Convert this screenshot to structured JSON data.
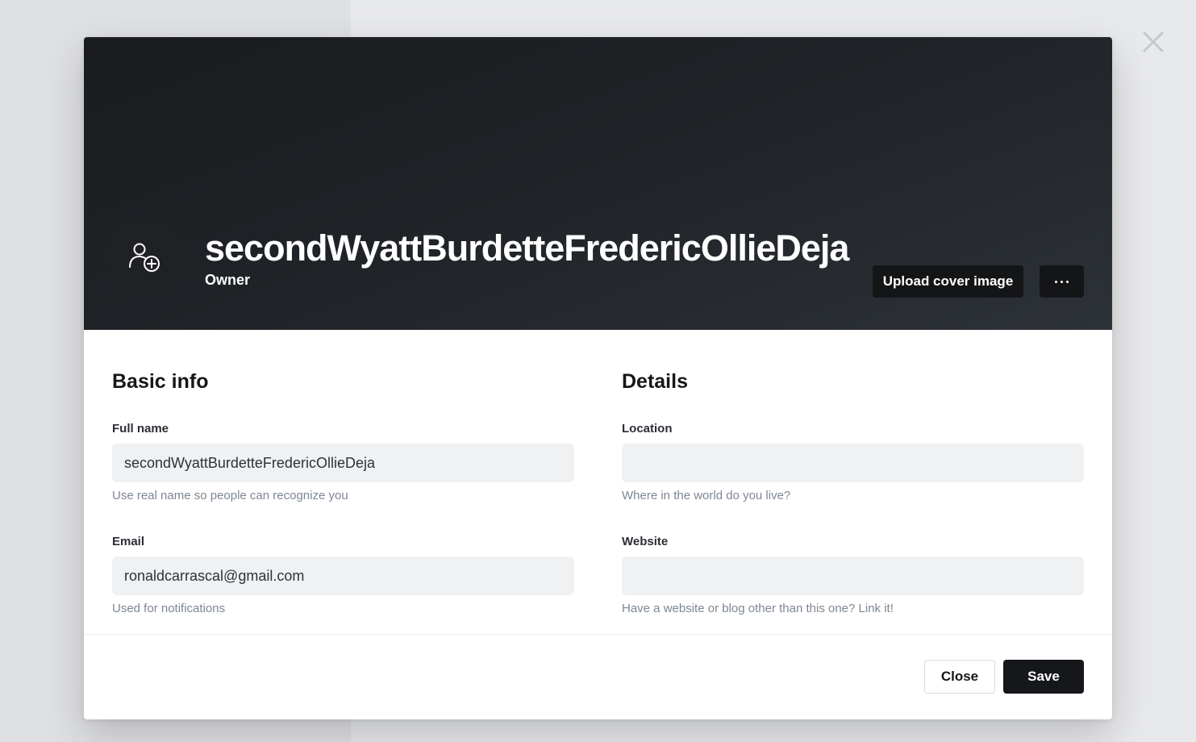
{
  "profile": {
    "name": "secondWyattBurdetteFredericOllieDeja",
    "role": "Owner",
    "avatar_icon": "user-add-icon"
  },
  "cover": {
    "upload_label": "Upload cover image",
    "more_icon": "ellipsis-icon"
  },
  "basic_info": {
    "title": "Basic info",
    "full_name": {
      "label": "Full name",
      "value": "secondWyattBurdetteFredericOllieDeja",
      "hint": "Use real name so people can recognize you"
    },
    "email": {
      "label": "Email",
      "value": "ronaldcarrascal@gmail.com",
      "hint": "Used for notifications"
    }
  },
  "details": {
    "title": "Details",
    "location": {
      "label": "Location",
      "value": "",
      "hint": "Where in the world do you live?"
    },
    "website": {
      "label": "Website",
      "value": "",
      "hint": "Have a website or blog other than this one? Link it!"
    }
  },
  "footer": {
    "close_label": "Close",
    "save_label": "Save"
  },
  "colors": {
    "cover_dark": "#1f2226",
    "primary_button": "#15171a",
    "input_bg": "#f0f1f3",
    "hint_text": "#7d8793"
  }
}
